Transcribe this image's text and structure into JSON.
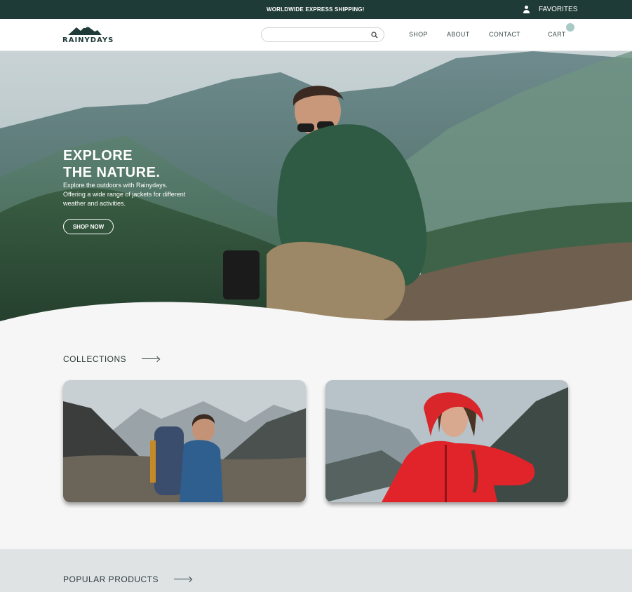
{
  "topbar": {
    "shipping": "WORLDWIDE EXPRESS SHIPPING!",
    "favorites": "FAVORITES"
  },
  "header": {
    "logo": "RAINYDAYS",
    "search_placeholder": "",
    "nav": [
      "SHOP",
      "ABOUT",
      "CONTACT",
      "CART"
    ]
  },
  "hero": {
    "title_line1": "EXPLORE",
    "title_line2": "THE NATURE.",
    "text": "Explore the outdoors with Rainydays. Offering a wide range of jackets for different weather and activities.",
    "button": "SHOP NOW"
  },
  "collections": {
    "title": "COLLECTIONS"
  },
  "popular": {
    "title": "POPULAR PRODUCTS"
  },
  "colors": {
    "dark_green": "#1f3b37",
    "accent": "#a9c9c7",
    "jacket_red": "#e0242a",
    "jacket_blue": "#2f5f8f"
  }
}
